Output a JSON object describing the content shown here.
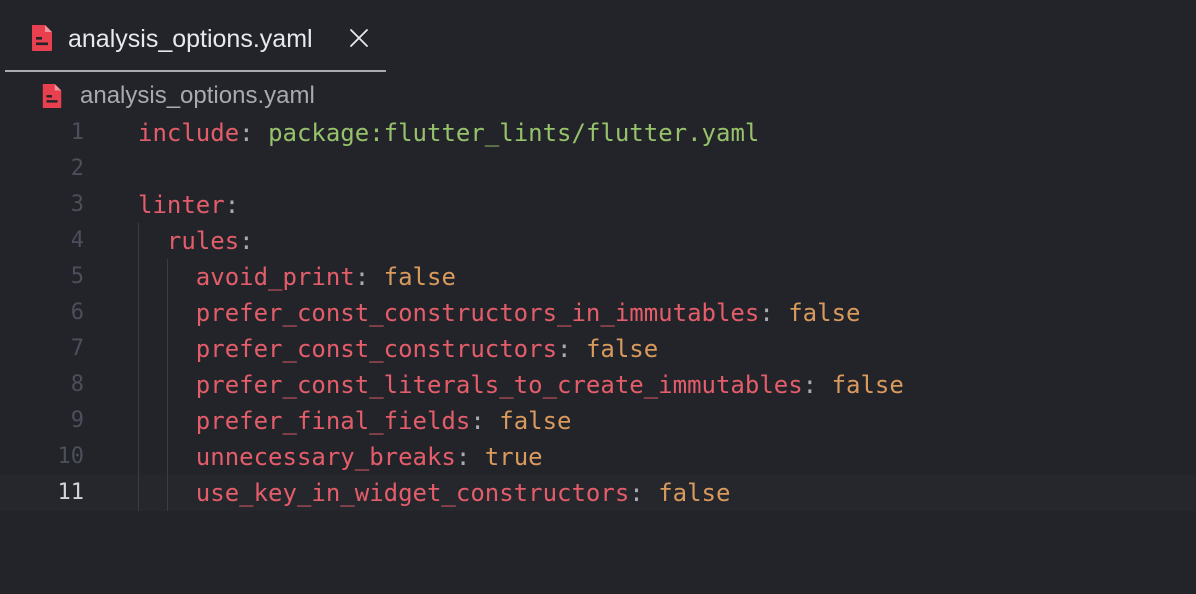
{
  "tab": {
    "label": "analysis_options.yaml",
    "icon": "yaml-file-icon",
    "close_icon": "close-icon"
  },
  "breadcrumb": {
    "label": "analysis_options.yaml",
    "icon": "yaml-file-icon"
  },
  "colors": {
    "background": "#232429",
    "key": "#e35d6a",
    "string": "#97c26c",
    "boolean": "#d99a5e",
    "punctuation": "#a9abb2",
    "line_number": "#4b4f5c",
    "line_number_active": "#d3d5dc",
    "file_icon": "#e8404f"
  },
  "editor": {
    "current_line": 11,
    "lines": [
      {
        "num": "1",
        "indent": "",
        "key": "include",
        "sep": ": ",
        "value": "package:flutter_lints/flutter.yaml",
        "value_type": "str"
      },
      {
        "num": "2",
        "indent": "",
        "key": "",
        "sep": "",
        "value": "",
        "value_type": ""
      },
      {
        "num": "3",
        "indent": "",
        "key": "linter",
        "sep": ":",
        "value": "",
        "value_type": ""
      },
      {
        "num": "4",
        "indent": "  ",
        "key": "rules",
        "sep": ":",
        "value": "",
        "value_type": ""
      },
      {
        "num": "5",
        "indent": "    ",
        "key": "avoid_print",
        "sep": ": ",
        "value": "false",
        "value_type": "bool"
      },
      {
        "num": "6",
        "indent": "    ",
        "key": "prefer_const_constructors_in_immutables",
        "sep": ": ",
        "value": "false",
        "value_type": "bool"
      },
      {
        "num": "7",
        "indent": "    ",
        "key": "prefer_const_constructors",
        "sep": ": ",
        "value": "false",
        "value_type": "bool"
      },
      {
        "num": "8",
        "indent": "    ",
        "key": "prefer_const_literals_to_create_immutables",
        "sep": ": ",
        "value": "false",
        "value_type": "bool"
      },
      {
        "num": "9",
        "indent": "    ",
        "key": "prefer_final_fields",
        "sep": ": ",
        "value": "false",
        "value_type": "bool"
      },
      {
        "num": "10",
        "indent": "    ",
        "key": "unnecessary_breaks",
        "sep": ": ",
        "value": "true",
        "value_type": "bool"
      },
      {
        "num": "11",
        "indent": "    ",
        "key": "use_key_in_widget_constructors",
        "sep": ": ",
        "value": "false",
        "value_type": "bool"
      }
    ]
  }
}
